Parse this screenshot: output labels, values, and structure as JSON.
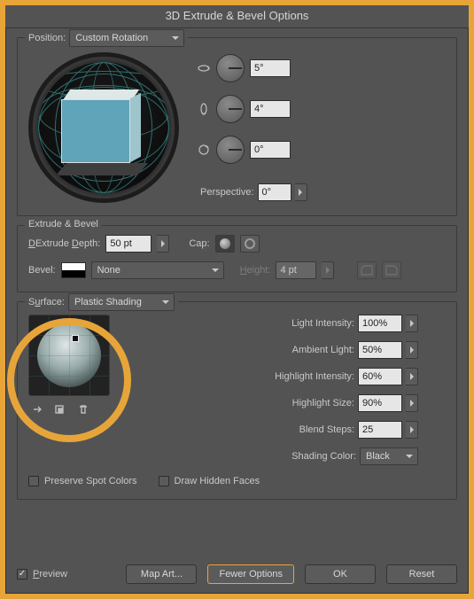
{
  "title": "3D Extrude & Bevel Options",
  "position": {
    "group_label": "",
    "label": "Position:",
    "value": "Custom Rotation",
    "angles": {
      "x_value": "5°",
      "y_value": "4°",
      "z_value": "0°"
    },
    "perspective_label": "Perspective:",
    "perspective_value": "0°"
  },
  "extrude": {
    "group_label": "Extrude & Bevel",
    "depth_label": "Extrude Depth:",
    "depth_value": "50 pt",
    "cap_label": "Cap:",
    "bevel_label": "Bevel:",
    "bevel_value": "None",
    "height_label": "Height:",
    "height_value": "4 pt"
  },
  "surface": {
    "label": "Surface:",
    "value": "Plastic Shading",
    "light_intensity_label": "Light Intensity:",
    "light_intensity_value": "100%",
    "ambient_label": "Ambient Light:",
    "ambient_value": "50%",
    "highlight_intensity_label": "Highlight Intensity:",
    "highlight_intensity_value": "60%",
    "highlight_size_label": "Highlight Size:",
    "highlight_size_value": "90%",
    "blend_steps_label": "Blend Steps:",
    "blend_steps_value": "25",
    "shading_color_label": "Shading Color:",
    "shading_color_value": "Black",
    "preserve_spot_label": "Preserve Spot Colors",
    "draw_hidden_label": "Draw Hidden Faces"
  },
  "footer": {
    "preview_label": "Preview",
    "map_art": "Map Art...",
    "fewer_options": "Fewer Options",
    "ok": "OK",
    "reset": "Reset"
  }
}
